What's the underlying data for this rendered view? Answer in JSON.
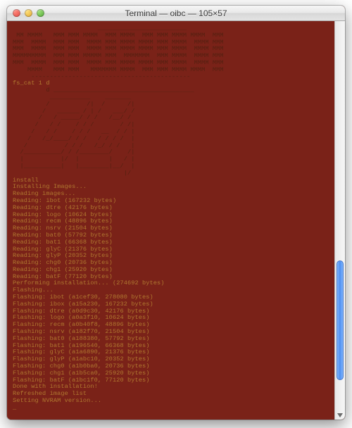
{
  "window": {
    "title": "Terminal — oibc — 105×57",
    "close_icon": "close",
    "minimize_icon": "minimize",
    "zoom_icon": "zoom"
  },
  "ascii_banner_top": [
    "                       ________________________",
    " MM MMMM   MMM MMM MMMM  MMM MMMM  MMM MMM MMMM MMMM  MMM",
    "MMM  MMMM  MMM MMM  MMMM MMM MMMM MMMM MMM MMMM  MMMM MMM",
    "MMM  MMMM  MMM MMM  MMMM MMM MMMM MMMM MMM MMMM  MMMM MMM",
    "MMMMMMMMM  MMM MMM MMMMM MMM  MMMMMMM  MMM MMMM  MMMM MMM",
    "MMM  MMMM  MMM MMM  MMMM MMM MMMM MMMM MMM MMMM  MMMM MMM",
    "    MMMM   MMM MMM   MMMMMMM MMMM  MMM MMM MMMM MMMM  MMM",
    "     -------------------------------------------"
  ],
  "fs_cat": "fs_cat 1 d",
  "ascii_banner_mid": [
    "         d ______________________________________",
    "          ___________    _______",
    "         /          /|  /      /|",
    "        /   ______ / | /   ___/ /",
    "       /   / _____/ / /   /__/ /",
    "      /   / /    / / /       / /|",
    "     /   / /    / / /   __  / / |",
    "    /   /_/____/ / /   / / / /  |",
    "   /          / / /   /_/ / /   |",
    "  /__________/ / /________/    /|",
    "  |          |/  |        |   / |",
    "  |__________|   |________|__/  |",
    "                              |/"
  ],
  "steps": {
    "install": "install",
    "installing": "Installing Images...",
    "reading_images": "Reading images..."
  },
  "reading": [
    "Reading: ibot (167232 bytes)",
    "Reading: dtre (42176 bytes)",
    "Reading: logo (10624 bytes)",
    "Reading: recm (48896 bytes)",
    "Reading: nsrv (21504 bytes)",
    "Reading: bat0 (57792 bytes)",
    "Reading: bat1 (66368 bytes)",
    "Reading: glyC (21376 bytes)",
    "Reading: glyP (20352 bytes)",
    "Reading: chg0 (20736 bytes)",
    "Reading: chg1 (25920 bytes)",
    "Reading: batF (77120 bytes)"
  ],
  "performing": "Performing installation... (274692 bytes)",
  "flashing_header": "Flashing...",
  "flashing": [
    "Flashing: ibot (a1cef30, 278080 bytes)",
    "Flashing: ibox (a15a230, 167232 bytes)",
    "Flashing: dtre (a0d9c30, 42176 bytes)",
    "Flashing: logo (a0a3f10, 10624 bytes)",
    "Flashing: recm (a0b40f8, 48896 bytes)",
    "Flashing: nsrv (a182f70, 21504 bytes)",
    "Flashing: bat0 (a188380, 57792 bytes)",
    "Flashing: bat1 (a196540, 66368 bytes)",
    "Flashing: glyC (a1a6890, 21376 bytes)",
    "Flashing: glyP (a1abc10, 20352 bytes)",
    "Flashing: chg0 (a1b0ba0, 20736 bytes)",
    "Flashing: chg1 (a1b5ca0, 25920 bytes)",
    "Flashing: batF (a1bc1f0, 77120 bytes)"
  ],
  "done": "Done with installation!",
  "refreshed": "Refreshed image list",
  "nvram": "Setting NVRAM version...",
  "cursor": "_"
}
